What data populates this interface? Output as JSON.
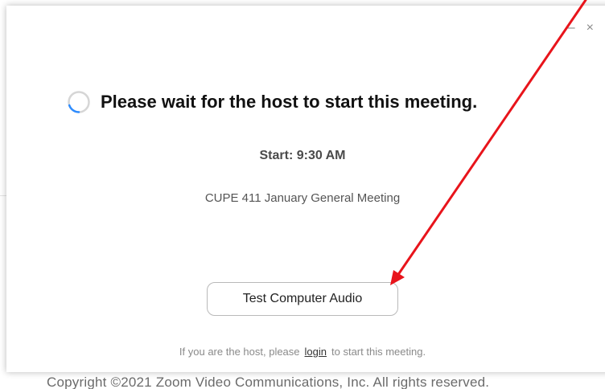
{
  "background": {
    "copyright_text": "Copyright ©2021 Zoom Video Communications, Inc. All rights reserved."
  },
  "dialog": {
    "minimize_glyph": "–",
    "close_glyph": "×",
    "wait_message": "Please wait for the host to start this meeting.",
    "start_time": "Start: 9:30 AM",
    "meeting_title": "CUPE 411 January General Meeting",
    "test_audio_button": "Test Computer Audio",
    "host_prefix": "If you are the host, please",
    "host_link": "login",
    "host_suffix": "to start this meeting."
  },
  "icons": {
    "spinner": "loading-spinner-icon",
    "minimize": "minimize-icon",
    "close": "close-icon"
  },
  "colors": {
    "spinner_accent": "#2d8cff",
    "annotation_arrow": "#e8141b"
  }
}
